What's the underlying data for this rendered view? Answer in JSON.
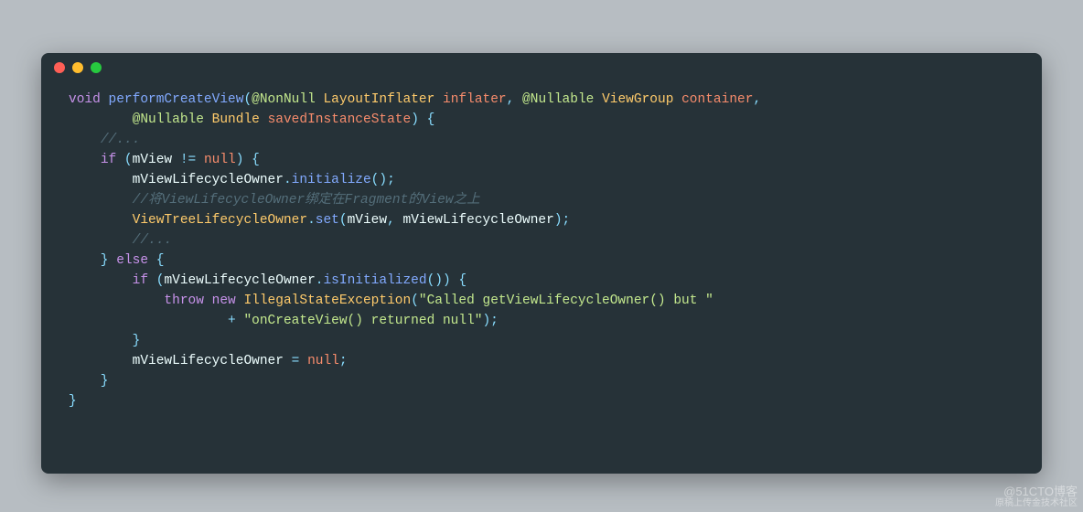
{
  "window": {
    "dots": {
      "red": "#ff5f56",
      "yellow": "#ffbd2e",
      "green": "#27c93f"
    }
  },
  "code": {
    "tokens": [
      [
        [
          "kw",
          "void"
        ],
        [
          "punc",
          " "
        ],
        [
          "fn",
          "performCreateView"
        ],
        [
          "punc",
          "("
        ],
        [
          "anno",
          "@NonNull"
        ],
        [
          "punc",
          " "
        ],
        [
          "type",
          "LayoutInflater"
        ],
        [
          "punc",
          " "
        ],
        [
          "param",
          "inflater"
        ],
        [
          "punc",
          ", "
        ],
        [
          "anno",
          "@Nullable"
        ],
        [
          "punc",
          " "
        ],
        [
          "type",
          "ViewGroup"
        ],
        [
          "punc",
          " "
        ],
        [
          "param",
          "container"
        ],
        [
          "punc",
          ","
        ]
      ],
      [
        [
          "punc",
          "        "
        ],
        [
          "anno",
          "@Nullable"
        ],
        [
          "punc",
          " "
        ],
        [
          "type",
          "Bundle"
        ],
        [
          "punc",
          " "
        ],
        [
          "param",
          "savedInstanceState"
        ],
        [
          "punc",
          ") {"
        ]
      ],
      [
        [
          "punc",
          "    "
        ],
        [
          "cmt",
          "//..."
        ]
      ],
      [
        [
          "punc",
          "    "
        ],
        [
          "kw",
          "if"
        ],
        [
          "punc",
          " ("
        ],
        [
          "field",
          "mView"
        ],
        [
          "punc",
          " != "
        ],
        [
          "null",
          "null"
        ],
        [
          "punc",
          ") {"
        ]
      ],
      [
        [
          "punc",
          "        "
        ],
        [
          "field",
          "mViewLifecycleOwner"
        ],
        [
          "punc",
          "."
        ],
        [
          "fn",
          "initialize"
        ],
        [
          "punc",
          "();"
        ]
      ],
      [
        [
          "punc",
          "        "
        ],
        [
          "cmt",
          "//将ViewLifecycleOwner绑定在Fragment的View之上"
        ]
      ],
      [
        [
          "punc",
          "        "
        ],
        [
          "type",
          "ViewTreeLifecycleOwner"
        ],
        [
          "punc",
          "."
        ],
        [
          "fn",
          "set"
        ],
        [
          "punc",
          "("
        ],
        [
          "field",
          "mView"
        ],
        [
          "punc",
          ", "
        ],
        [
          "field",
          "mViewLifecycleOwner"
        ],
        [
          "punc",
          ");"
        ]
      ],
      [
        [
          "punc",
          "        "
        ],
        [
          "cmt",
          "//..."
        ]
      ],
      [
        [
          "punc",
          "    } "
        ],
        [
          "kw",
          "else"
        ],
        [
          "punc",
          " {"
        ]
      ],
      [
        [
          "punc",
          "        "
        ],
        [
          "kw",
          "if"
        ],
        [
          "punc",
          " ("
        ],
        [
          "field",
          "mViewLifecycleOwner"
        ],
        [
          "punc",
          "."
        ],
        [
          "fn",
          "isInitialized"
        ],
        [
          "punc",
          "()) {"
        ]
      ],
      [
        [
          "punc",
          "            "
        ],
        [
          "kw",
          "throw"
        ],
        [
          "punc",
          " "
        ],
        [
          "kw",
          "new"
        ],
        [
          "punc",
          " "
        ],
        [
          "type",
          "IllegalStateException"
        ],
        [
          "punc",
          "("
        ],
        [
          "str",
          "\"Called getViewLifecycleOwner() but \""
        ]
      ],
      [
        [
          "punc",
          "                    + "
        ],
        [
          "str",
          "\"onCreateView() returned null\""
        ],
        [
          "punc",
          ");"
        ]
      ],
      [
        [
          "punc",
          "        }"
        ]
      ],
      [
        [
          "punc",
          "        "
        ],
        [
          "field",
          "mViewLifecycleOwner"
        ],
        [
          "punc",
          " = "
        ],
        [
          "null",
          "null"
        ],
        [
          "punc",
          ";"
        ]
      ],
      [
        [
          "punc",
          "    }"
        ]
      ],
      [
        [
          "punc",
          "}"
        ]
      ]
    ]
  },
  "watermark": {
    "line1": "@51CTO博客",
    "line2": "原稿上传金技术社区"
  }
}
